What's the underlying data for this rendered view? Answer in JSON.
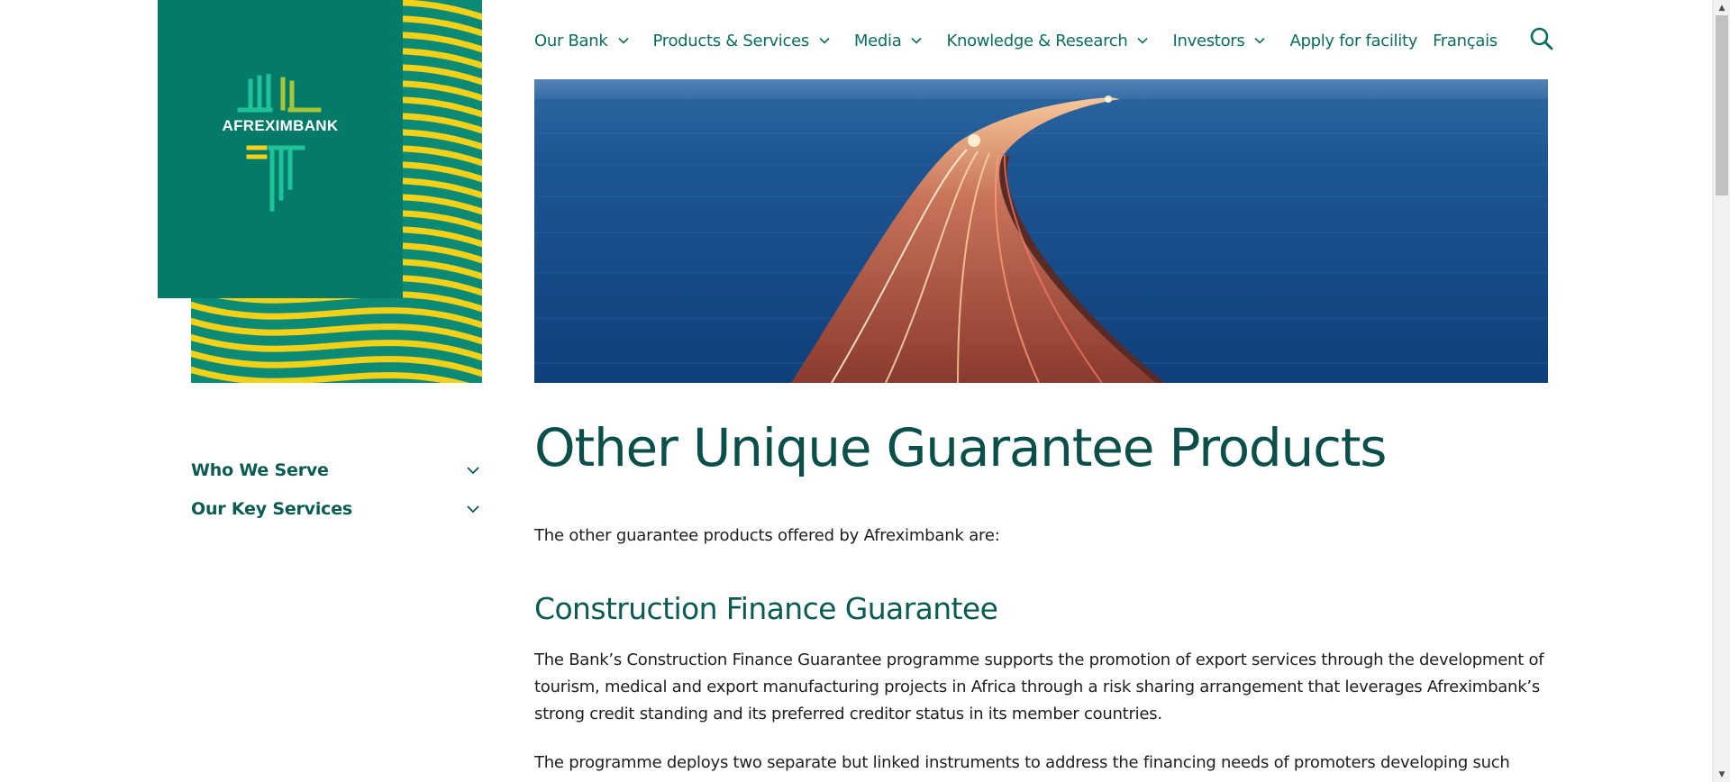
{
  "brand": {
    "name": "AFREXIMBANK",
    "colors": {
      "primary": "#047a69",
      "accent_yellow": "#f2d118",
      "link": "#0a6e60"
    }
  },
  "nav": {
    "items": [
      {
        "label": "Our Bank",
        "has_dropdown": true
      },
      {
        "label": "Products & Services",
        "has_dropdown": true
      },
      {
        "label": "Media",
        "has_dropdown": true
      },
      {
        "label": "Knowledge & Research",
        "has_dropdown": true
      },
      {
        "label": "Investors",
        "has_dropdown": true
      },
      {
        "label": "Apply for facility",
        "has_dropdown": false
      },
      {
        "label": "Français",
        "has_dropdown": false
      }
    ],
    "search_icon": "search-icon"
  },
  "hero": {
    "image": "bridge-over-sea-at-dusk"
  },
  "sidebar": {
    "items": [
      {
        "label": "Who We Serve"
      },
      {
        "label": "Our Key Services"
      }
    ]
  },
  "main": {
    "title": "Other Unique Guarantee Products",
    "intro": "The other guarantee products offered by Afreximbank are:",
    "sections": [
      {
        "heading": "Construction Finance Guarantee",
        "paragraphs": [
          "The Bank’s Construction Finance Guarantee programme supports the promotion of export services through the development of tourism, medical and export manufacturing projects in Africa through a risk sharing arrangement that leverages Afreximbank’s strong credit standing and its preferred creditor status in its member countries.",
          "The programme deploys two separate but linked instruments to address the financing needs of promoters developing such projects in"
        ]
      }
    ]
  }
}
